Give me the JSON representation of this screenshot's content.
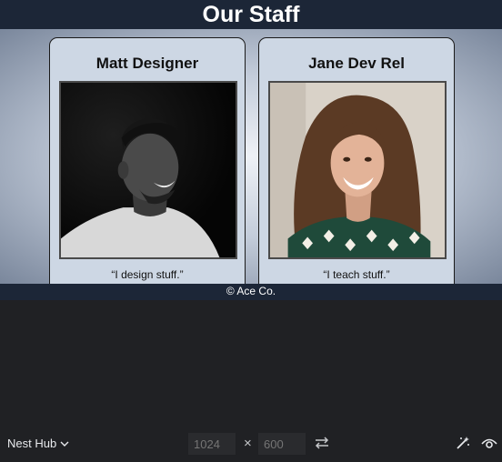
{
  "site": {
    "title": "Our Staff",
    "footer": "© Ace Co."
  },
  "staff": [
    {
      "name": "Matt Designer",
      "quote": "“I design stuff.”",
      "photo_icon": "portrait-photo"
    },
    {
      "name": "Jane Dev Rel",
      "quote": "“I teach stuff.”",
      "photo_icon": "portrait-photo"
    }
  ],
  "toolbar": {
    "device": "Nest Hub",
    "width_placeholder": "1024",
    "height_placeholder": "600",
    "times": "×"
  },
  "colors": {
    "header_bg": "#1c2637",
    "card_bg": "#cdd7e4",
    "devtools_bg": "#202124"
  }
}
